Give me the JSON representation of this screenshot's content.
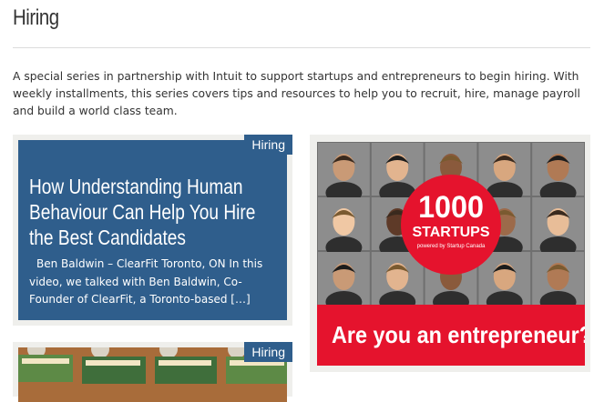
{
  "page": {
    "title": "Hiring",
    "intro": "A special series in partnership with Intuit to support startups and entrepreneurs to begin hiring. With weekly installments, this series covers tips and resources to help you to recruit, hire, manage payroll and build a world class team."
  },
  "posts": [
    {
      "category": "Hiring",
      "title": "How Understanding Human Behaviour Can Help You Hire the Best Candidates",
      "excerpt": "Ben Baldwin – ClearFit Toronto, ON In this video, we talked with Ben Baldwin, Co-Founder of ClearFit, a Toronto-based […]"
    },
    {
      "category": "Hiring"
    }
  ],
  "ad": {
    "number": "1000",
    "word": "STARTUPS",
    "tagline": "powered by Startup Canada",
    "cta": "Are you an entrepreneur?"
  },
  "colors": {
    "card_blue": "#2f5e8c",
    "ad_red": "#e5132d"
  }
}
